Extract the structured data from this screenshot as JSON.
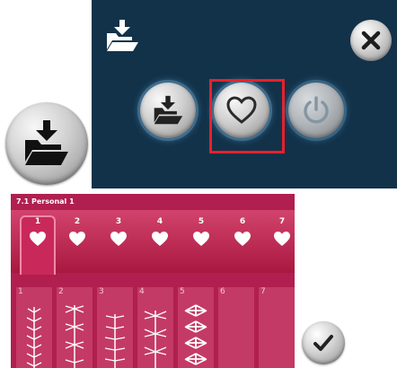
{
  "colors": {
    "dialog_bg": "#12324a",
    "highlight": "#e8202a",
    "panel_bg": "#b01f4f"
  },
  "dialog": {
    "icons": [
      "load-folder-icon",
      "close-icon",
      "load-folder-icon",
      "heart-icon",
      "power-icon"
    ]
  },
  "personal_menu": {
    "title": "7.1 Personal 1",
    "tabs": [
      "1",
      "2",
      "3",
      "4",
      "5",
      "6",
      "7"
    ],
    "columns": [
      "1",
      "2",
      "3",
      "4",
      "5",
      "6",
      "7"
    ]
  },
  "confirm": {
    "icon": "checkmark-icon"
  }
}
